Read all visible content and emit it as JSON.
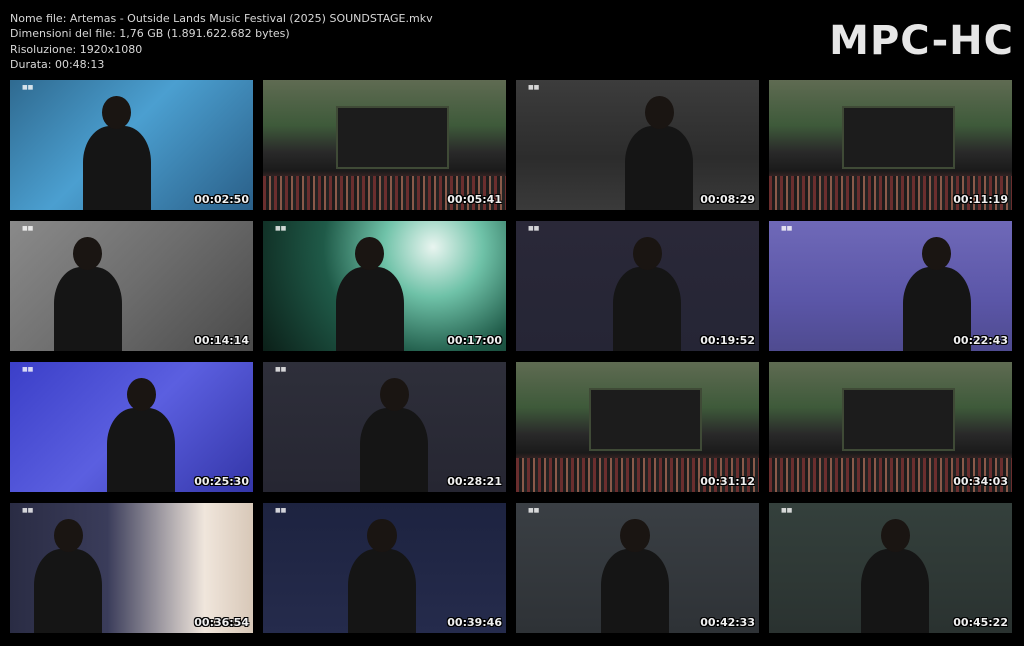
{
  "info": {
    "filename": "Nome file: Artemas - Outside Lands Music Festival (2025) SOUNDSTAGE.mkv",
    "filesize": "Dimensioni del file: 1,76 GB (1.891.622.682 bytes)",
    "resolution": "Risoluzione: 1920x1080",
    "duration": "Durata: 00:48:13"
  },
  "logo": "MPC-HC",
  "thumbnails": [
    {
      "time": "00:02:50",
      "scene": "blue"
    },
    {
      "time": "00:05:41",
      "scene": "stage"
    },
    {
      "time": "00:08:29",
      "scene": "grey"
    },
    {
      "time": "00:11:19",
      "scene": "stage"
    },
    {
      "time": "00:14:14",
      "scene": "lgrey"
    },
    {
      "time": "00:17:00",
      "scene": "teal"
    },
    {
      "time": "00:19:52",
      "scene": "purple"
    },
    {
      "time": "00:22:43",
      "scene": "violet"
    },
    {
      "time": "00:25:30",
      "scene": "indigo"
    },
    {
      "time": "00:28:21",
      "scene": "dark"
    },
    {
      "time": "00:31:12",
      "scene": "stage"
    },
    {
      "time": "00:34:03",
      "scene": "stage"
    },
    {
      "time": "00:36:54",
      "scene": "bright"
    },
    {
      "time": "00:39:46",
      "scene": "navy"
    },
    {
      "time": "00:42:33",
      "scene": "slate"
    },
    {
      "time": "00:45:22",
      "scene": "forest"
    }
  ]
}
